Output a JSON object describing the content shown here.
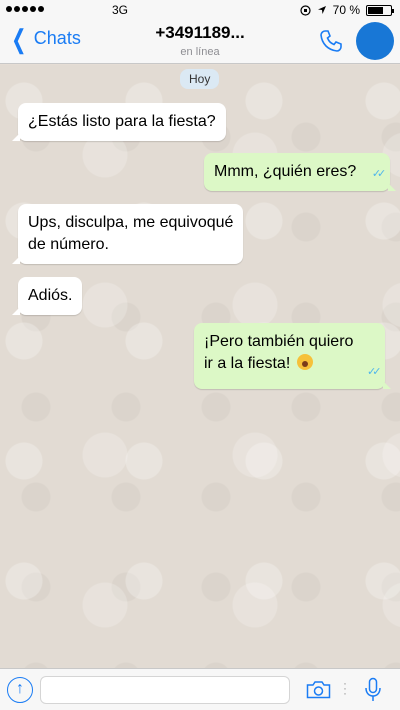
{
  "status_bar": {
    "carrier": "3G",
    "battery_text": "70 %",
    "battery_level": 0.7
  },
  "header": {
    "back_label": "Chats",
    "contact_name": "+3491189...",
    "contact_status": "en línea"
  },
  "chat": {
    "date_label": "Hoy",
    "messages": [
      {
        "direction": "in",
        "text": "¿Estás listo para la fiesta?"
      },
      {
        "direction": "out",
        "text": "Mmm, ¿quién eres?",
        "status": "read"
      },
      {
        "direction": "in",
        "lines": [
          "Ups, disculpa, me equivoqué",
          "de número."
        ]
      },
      {
        "direction": "in",
        "text": "Adiós."
      },
      {
        "direction": "out",
        "lines": [
          "¡Pero también quiero",
          "ir a la fiesta!"
        ],
        "emoji": "astonished-face-icon",
        "status": "read"
      }
    ]
  },
  "input_bar": {
    "placeholder": ""
  },
  "colors": {
    "accent": "#1a7cf4",
    "outgoing_bubble": "#dcf8c6",
    "incoming_bubble": "#ffffff",
    "read_ticks": "#4fb6ec",
    "avatar": "#1877d6"
  }
}
